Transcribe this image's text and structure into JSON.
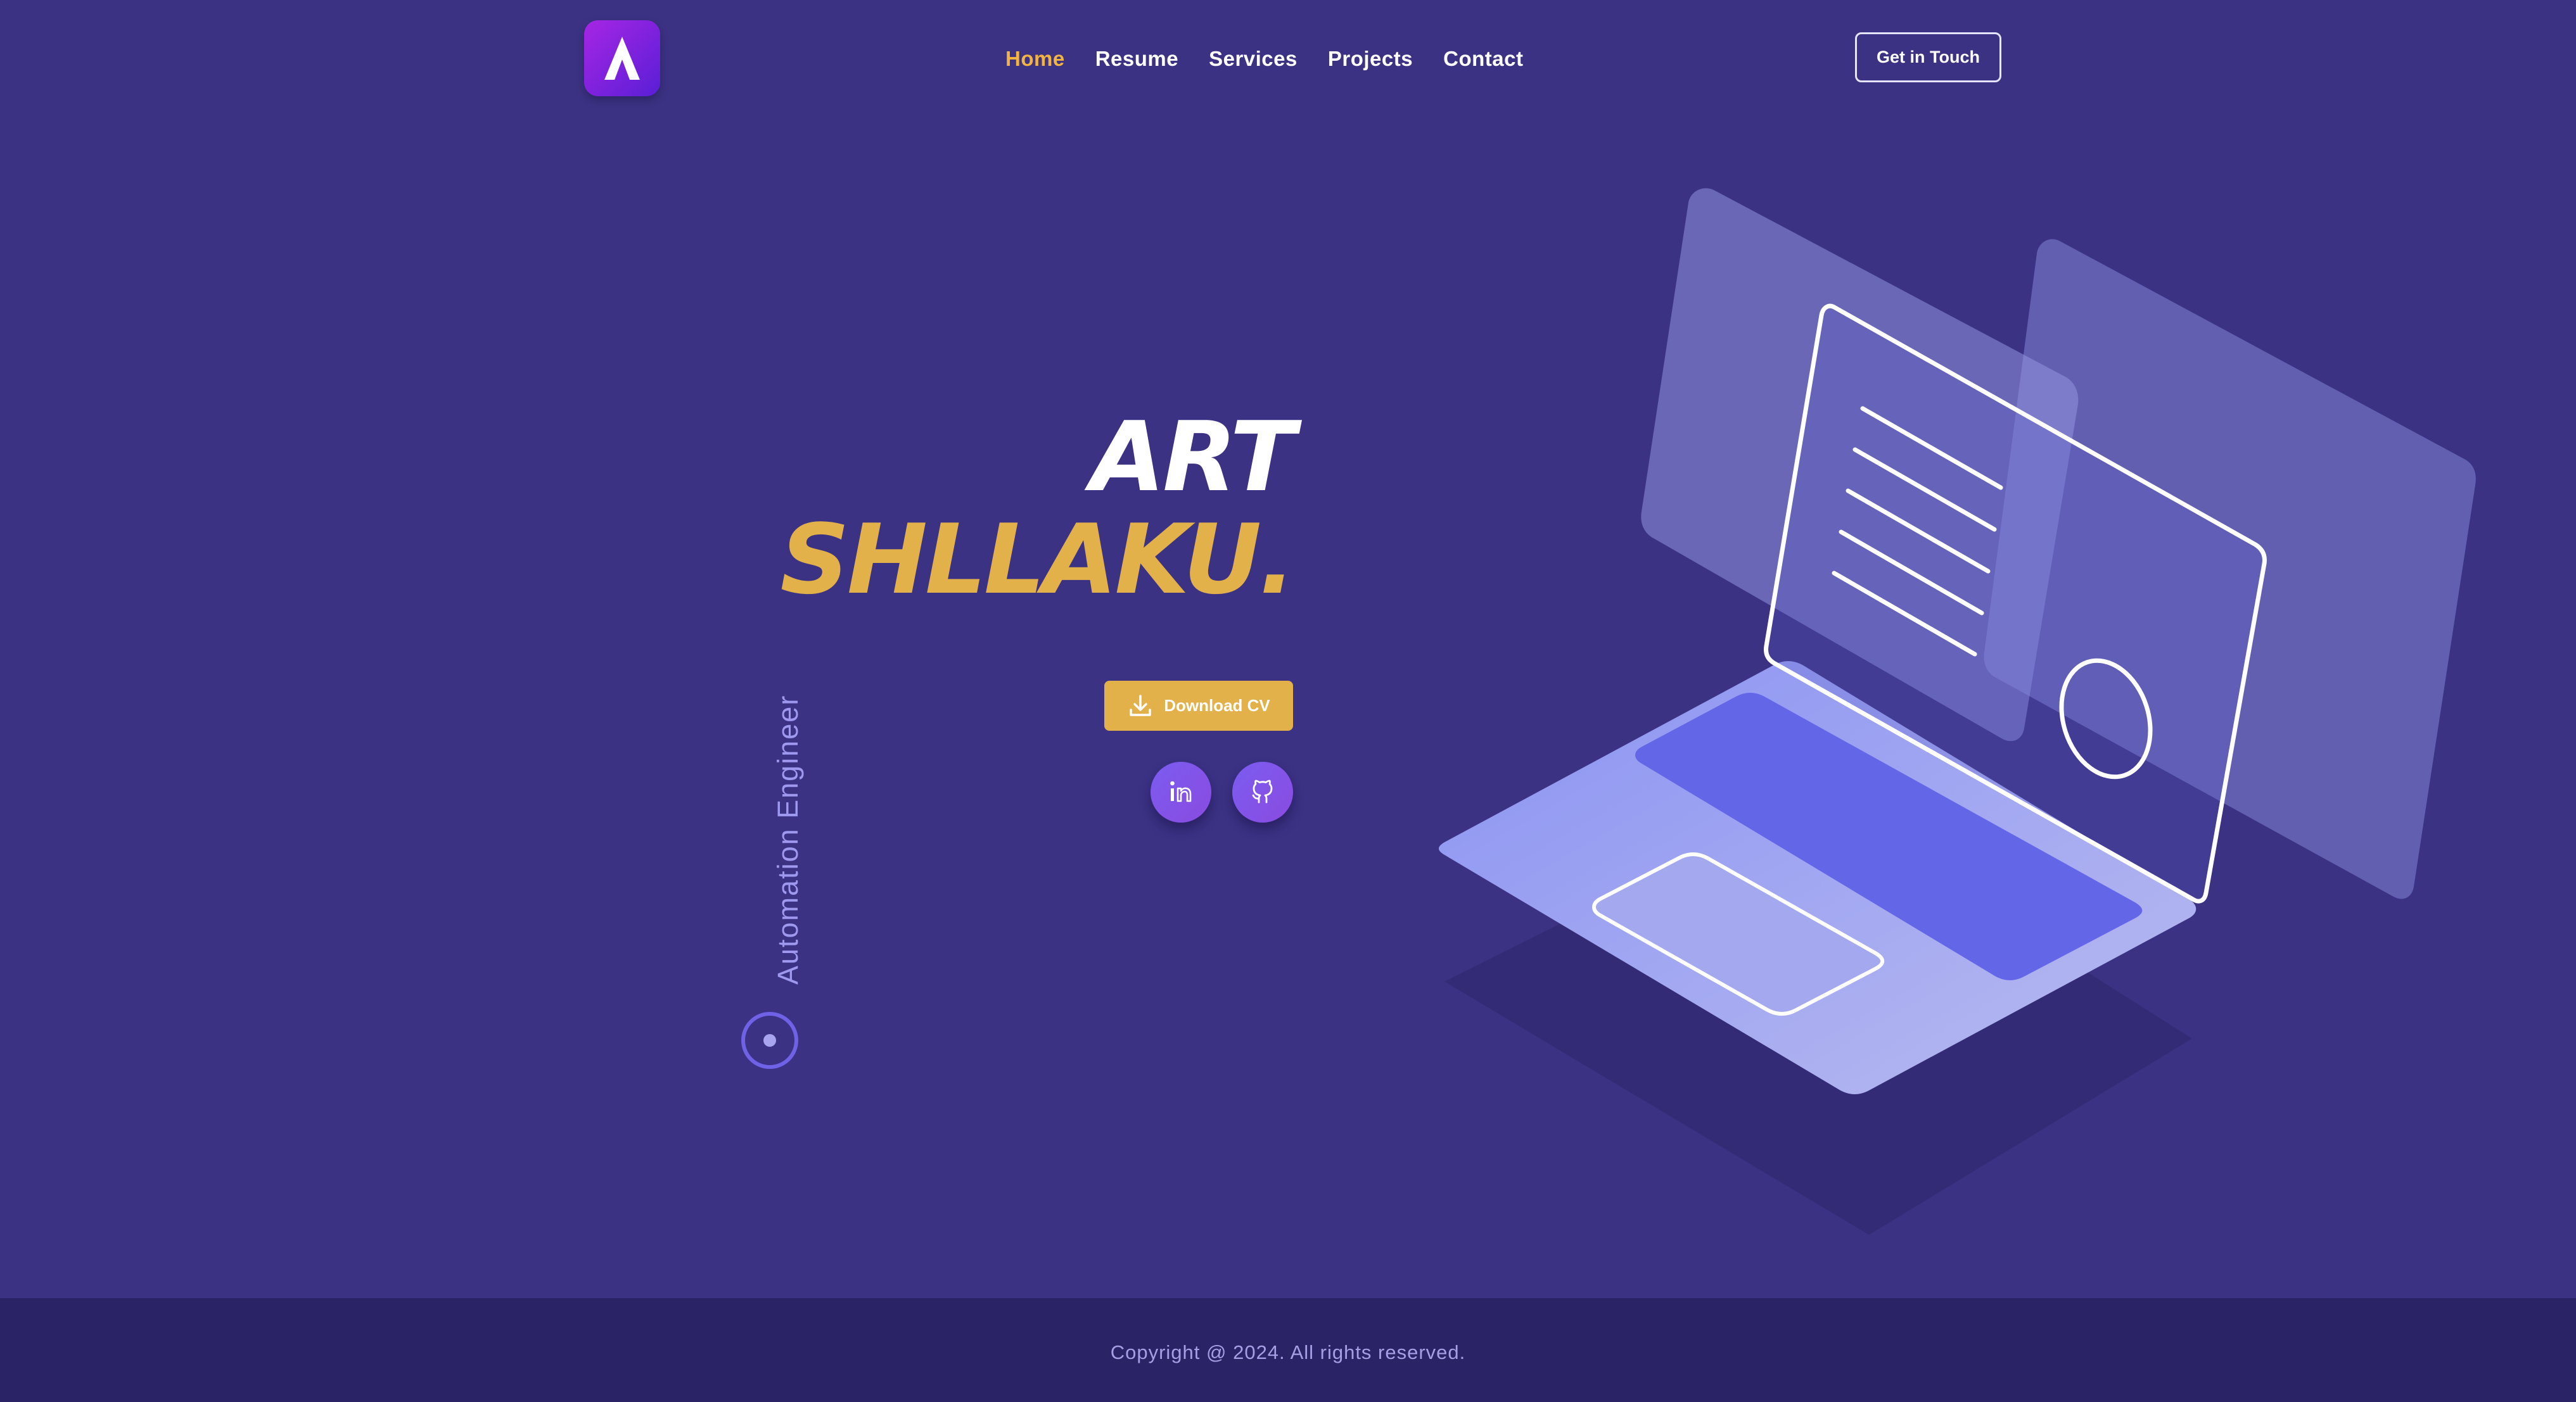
{
  "header": {
    "logo_icon": "logo-mark-icon",
    "nav": [
      {
        "label": "Home",
        "active": true
      },
      {
        "label": "Resume",
        "active": false
      },
      {
        "label": "Services",
        "active": false
      },
      {
        "label": "Projects",
        "active": false
      },
      {
        "label": "Contact",
        "active": false
      }
    ],
    "cta_label": "Get in Touch"
  },
  "hero": {
    "first_name": "ART",
    "last_name": "SHLLAKU.",
    "download_label": "Download CV",
    "download_icon": "download-icon",
    "socials": [
      {
        "name": "LinkedIn",
        "icon": "linkedin-icon"
      },
      {
        "name": "GitHub",
        "icon": "github-icon"
      }
    ],
    "role": "Automation Engineer",
    "illustration": "laptop-illustration"
  },
  "footer": {
    "copyright": "Copyright @ 2024. All rights reserved."
  },
  "colors": {
    "background": "#3b3284",
    "accent": "#e2b14a",
    "nav_active": "#f3b341",
    "footer": "#2a2467"
  }
}
